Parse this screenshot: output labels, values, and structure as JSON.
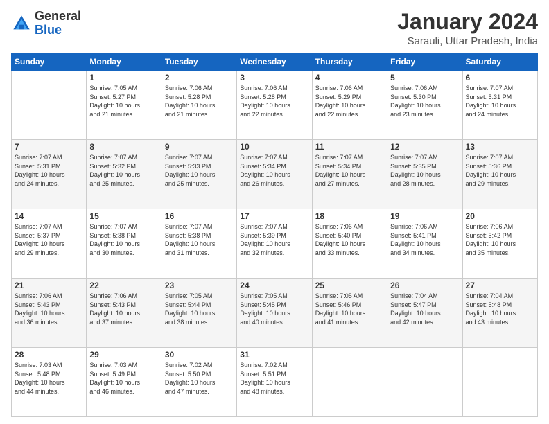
{
  "header": {
    "logo_line1": "General",
    "logo_line2": "Blue",
    "title": "January 2024",
    "subtitle": "Sarauli, Uttar Pradesh, India"
  },
  "days": [
    "Sunday",
    "Monday",
    "Tuesday",
    "Wednesday",
    "Thursday",
    "Friday",
    "Saturday"
  ],
  "weeks": [
    [
      {
        "day": "",
        "text": ""
      },
      {
        "day": "1",
        "text": "Sunrise: 7:05 AM\nSunset: 5:27 PM\nDaylight: 10 hours\nand 21 minutes."
      },
      {
        "day": "2",
        "text": "Sunrise: 7:06 AM\nSunset: 5:28 PM\nDaylight: 10 hours\nand 21 minutes."
      },
      {
        "day": "3",
        "text": "Sunrise: 7:06 AM\nSunset: 5:28 PM\nDaylight: 10 hours\nand 22 minutes."
      },
      {
        "day": "4",
        "text": "Sunrise: 7:06 AM\nSunset: 5:29 PM\nDaylight: 10 hours\nand 22 minutes."
      },
      {
        "day": "5",
        "text": "Sunrise: 7:06 AM\nSunset: 5:30 PM\nDaylight: 10 hours\nand 23 minutes."
      },
      {
        "day": "6",
        "text": "Sunrise: 7:07 AM\nSunset: 5:31 PM\nDaylight: 10 hours\nand 24 minutes."
      }
    ],
    [
      {
        "day": "7",
        "text": "Sunrise: 7:07 AM\nSunset: 5:31 PM\nDaylight: 10 hours\nand 24 minutes."
      },
      {
        "day": "8",
        "text": "Sunrise: 7:07 AM\nSunset: 5:32 PM\nDaylight: 10 hours\nand 25 minutes."
      },
      {
        "day": "9",
        "text": "Sunrise: 7:07 AM\nSunset: 5:33 PM\nDaylight: 10 hours\nand 25 minutes."
      },
      {
        "day": "10",
        "text": "Sunrise: 7:07 AM\nSunset: 5:34 PM\nDaylight: 10 hours\nand 26 minutes."
      },
      {
        "day": "11",
        "text": "Sunrise: 7:07 AM\nSunset: 5:34 PM\nDaylight: 10 hours\nand 27 minutes."
      },
      {
        "day": "12",
        "text": "Sunrise: 7:07 AM\nSunset: 5:35 PM\nDaylight: 10 hours\nand 28 minutes."
      },
      {
        "day": "13",
        "text": "Sunrise: 7:07 AM\nSunset: 5:36 PM\nDaylight: 10 hours\nand 29 minutes."
      }
    ],
    [
      {
        "day": "14",
        "text": "Sunrise: 7:07 AM\nSunset: 5:37 PM\nDaylight: 10 hours\nand 29 minutes."
      },
      {
        "day": "15",
        "text": "Sunrise: 7:07 AM\nSunset: 5:38 PM\nDaylight: 10 hours\nand 30 minutes."
      },
      {
        "day": "16",
        "text": "Sunrise: 7:07 AM\nSunset: 5:38 PM\nDaylight: 10 hours\nand 31 minutes."
      },
      {
        "day": "17",
        "text": "Sunrise: 7:07 AM\nSunset: 5:39 PM\nDaylight: 10 hours\nand 32 minutes."
      },
      {
        "day": "18",
        "text": "Sunrise: 7:06 AM\nSunset: 5:40 PM\nDaylight: 10 hours\nand 33 minutes."
      },
      {
        "day": "19",
        "text": "Sunrise: 7:06 AM\nSunset: 5:41 PM\nDaylight: 10 hours\nand 34 minutes."
      },
      {
        "day": "20",
        "text": "Sunrise: 7:06 AM\nSunset: 5:42 PM\nDaylight: 10 hours\nand 35 minutes."
      }
    ],
    [
      {
        "day": "21",
        "text": "Sunrise: 7:06 AM\nSunset: 5:43 PM\nDaylight: 10 hours\nand 36 minutes."
      },
      {
        "day": "22",
        "text": "Sunrise: 7:06 AM\nSunset: 5:43 PM\nDaylight: 10 hours\nand 37 minutes."
      },
      {
        "day": "23",
        "text": "Sunrise: 7:05 AM\nSunset: 5:44 PM\nDaylight: 10 hours\nand 38 minutes."
      },
      {
        "day": "24",
        "text": "Sunrise: 7:05 AM\nSunset: 5:45 PM\nDaylight: 10 hours\nand 40 minutes."
      },
      {
        "day": "25",
        "text": "Sunrise: 7:05 AM\nSunset: 5:46 PM\nDaylight: 10 hours\nand 41 minutes."
      },
      {
        "day": "26",
        "text": "Sunrise: 7:04 AM\nSunset: 5:47 PM\nDaylight: 10 hours\nand 42 minutes."
      },
      {
        "day": "27",
        "text": "Sunrise: 7:04 AM\nSunset: 5:48 PM\nDaylight: 10 hours\nand 43 minutes."
      }
    ],
    [
      {
        "day": "28",
        "text": "Sunrise: 7:03 AM\nSunset: 5:48 PM\nDaylight: 10 hours\nand 44 minutes."
      },
      {
        "day": "29",
        "text": "Sunrise: 7:03 AM\nSunset: 5:49 PM\nDaylight: 10 hours\nand 46 minutes."
      },
      {
        "day": "30",
        "text": "Sunrise: 7:02 AM\nSunset: 5:50 PM\nDaylight: 10 hours\nand 47 minutes."
      },
      {
        "day": "31",
        "text": "Sunrise: 7:02 AM\nSunset: 5:51 PM\nDaylight: 10 hours\nand 48 minutes."
      },
      {
        "day": "",
        "text": ""
      },
      {
        "day": "",
        "text": ""
      },
      {
        "day": "",
        "text": ""
      }
    ]
  ]
}
